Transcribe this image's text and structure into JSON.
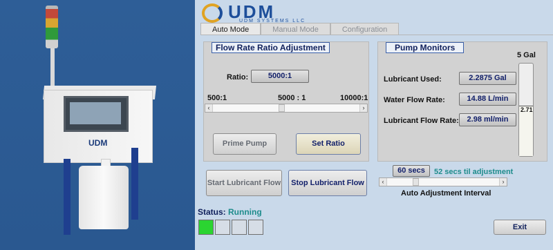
{
  "hmi": {
    "brand": "UDM",
    "brand_sub": "UDM SYSTEMS LLC",
    "tabs": [
      {
        "label": "Auto Mode",
        "active": true
      },
      {
        "label": "Manual Mode",
        "active": false
      },
      {
        "label": "Configuration",
        "active": false
      }
    ],
    "flow_ratio": {
      "title": "Flow Rate Ratio Adjustment",
      "ratio_label": "Ratio:",
      "ratio_value": "5000:1",
      "scale_min": "500:1",
      "scale_mid": "5000 : 1",
      "scale_max": "10000:1",
      "slider_fraction": 0.47,
      "prime_button": "Prime Pump",
      "set_button": "Set Ratio"
    },
    "pump_monitors": {
      "title": "Pump Monitors",
      "tank_capacity": "5 Gal",
      "tank_level_text": "2.71",
      "tank_level_fraction": 0.542,
      "rows": [
        {
          "label": "Lubricant Used:",
          "value": "2.2875 Gal"
        },
        {
          "label": "Water Flow Rate:",
          "value": "14.88 L/min"
        },
        {
          "label": "Lubricant Flow Rate:",
          "value": "2.98 ml/min"
        }
      ]
    },
    "start_button": "Start Lubricant Flow",
    "stop_button": "Stop Lubricant Flow",
    "interval": {
      "value": "60 secs",
      "countdown": "52 secs til adjustment",
      "label": "Auto Adjustment Interval",
      "slider_fraction": 0.24
    },
    "status": {
      "label": "Status:",
      "value": "Running",
      "lights": [
        true,
        false,
        false,
        false
      ]
    },
    "exit_button": "Exit"
  },
  "photo": {
    "cabinet_logo": "UDM"
  },
  "colors": {
    "background": "#2f5d94",
    "panel": "#c9d9ea",
    "running": "#1e8c8c",
    "light_on": "#2bd431"
  }
}
